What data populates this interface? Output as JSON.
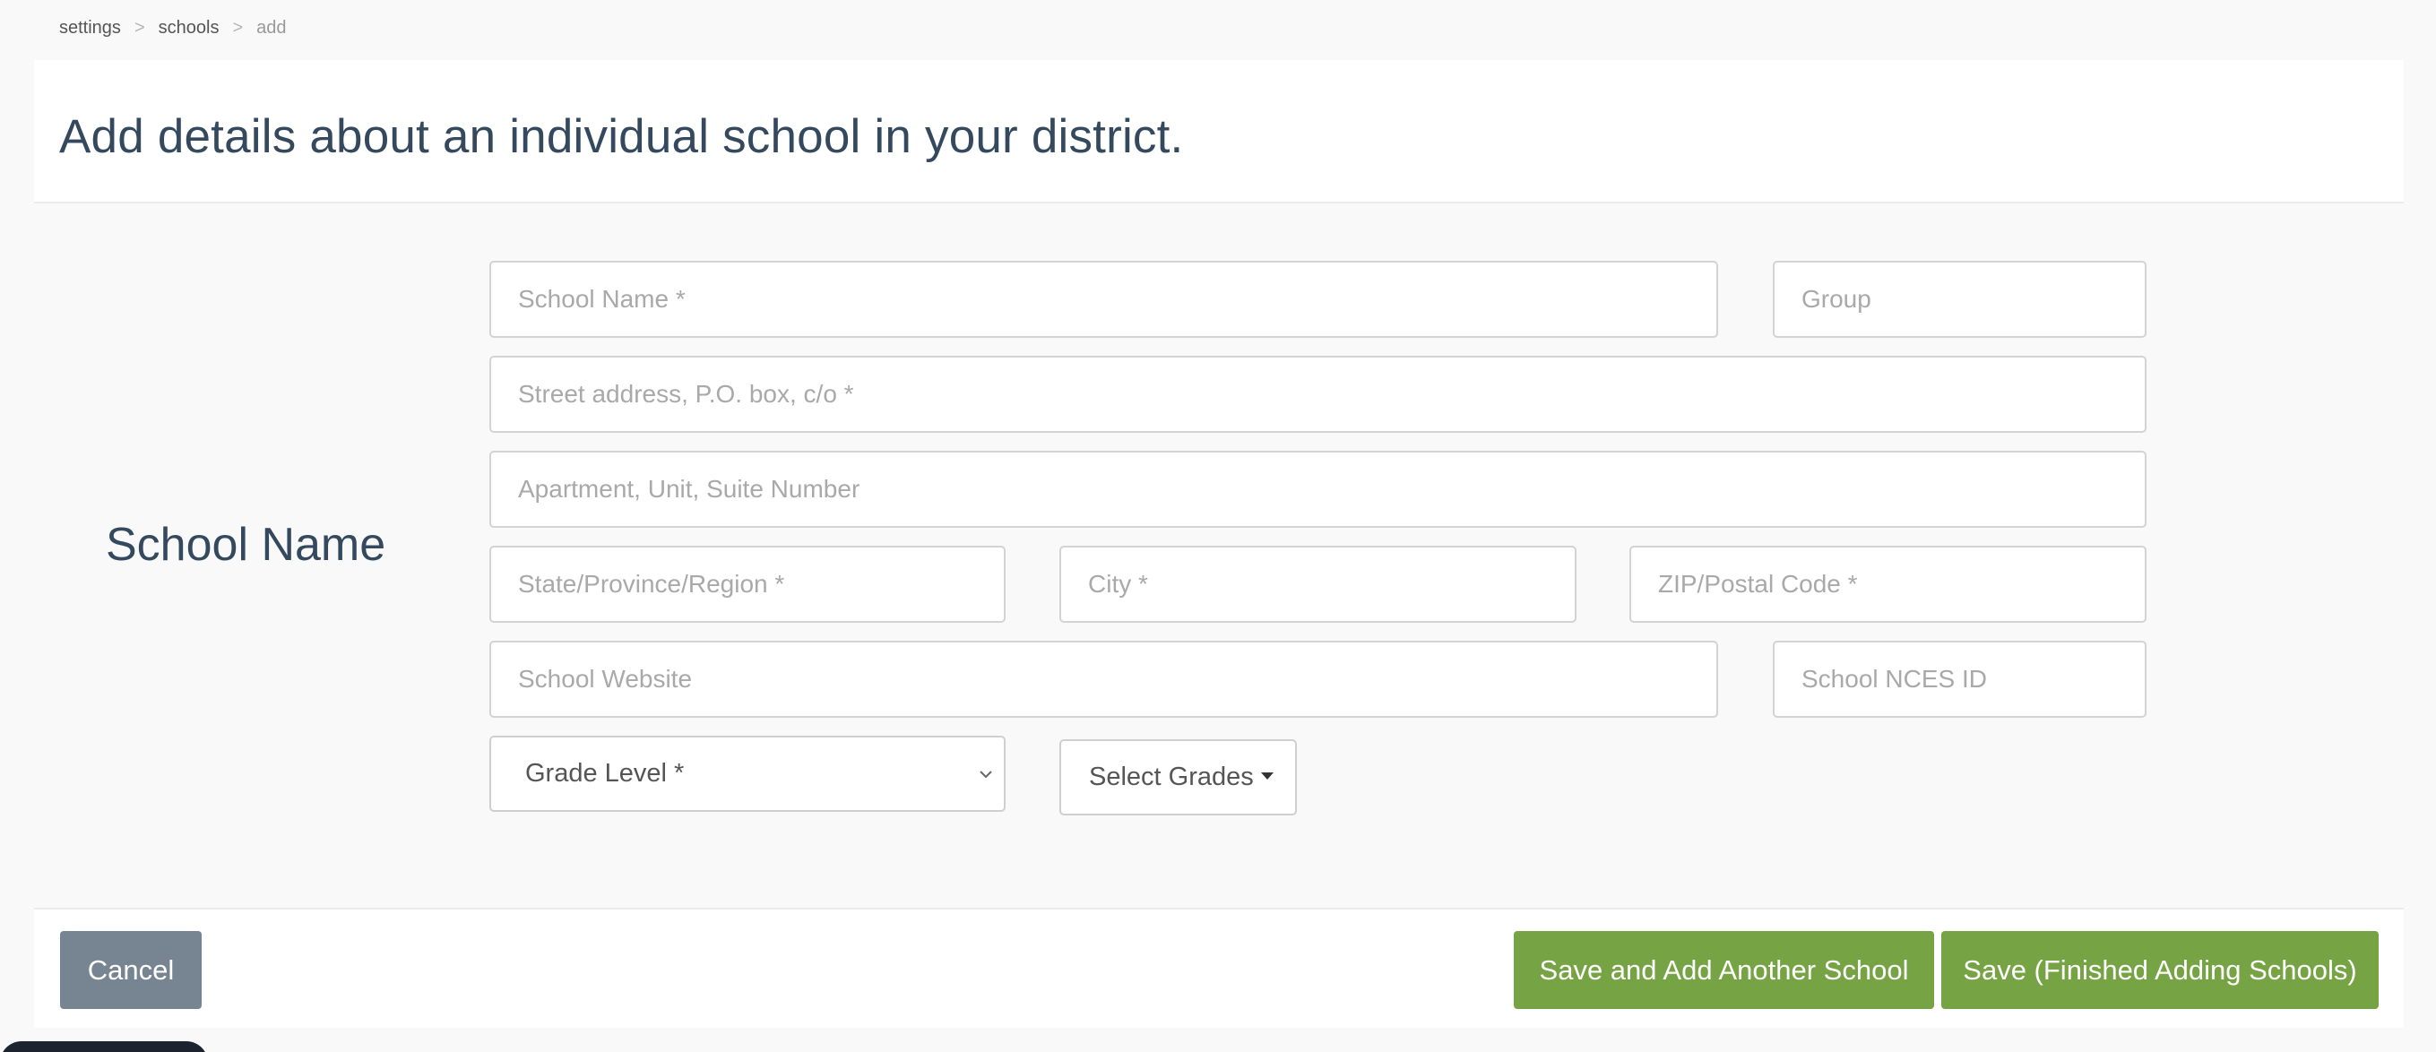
{
  "breadcrumb": {
    "items": [
      "settings",
      "schools",
      "add"
    ],
    "separator": ">"
  },
  "header": {
    "title": "Add details about an individual school in your district."
  },
  "section": {
    "label": "School Name"
  },
  "form": {
    "school_name": {
      "placeholder": "School Name *",
      "value": ""
    },
    "group": {
      "placeholder": "Group",
      "value": ""
    },
    "street": {
      "placeholder": "Street address, P.O. box, c/o *",
      "value": ""
    },
    "apartment": {
      "placeholder": "Apartment, Unit, Suite Number",
      "value": ""
    },
    "state": {
      "placeholder": "State/Province/Region *",
      "value": ""
    },
    "city": {
      "placeholder": "City *",
      "value": ""
    },
    "zip": {
      "placeholder": "ZIP/Postal Code *",
      "value": ""
    },
    "website": {
      "placeholder": "School Website",
      "value": ""
    },
    "nces_id": {
      "placeholder": "School NCES ID",
      "value": ""
    },
    "grade_level": {
      "selected": "Grade Level *"
    },
    "select_grades": {
      "label": "Select Grades"
    }
  },
  "footer": {
    "cancel_label": "Cancel",
    "save_add_another_label": "Save and Add Another School",
    "save_finished_label": "Save (Finished Adding Schools)"
  },
  "colors": {
    "primary_green": "#76a343",
    "cancel_gray": "#778592",
    "text_dark": "#34495e",
    "background": "#f9f9f9"
  }
}
